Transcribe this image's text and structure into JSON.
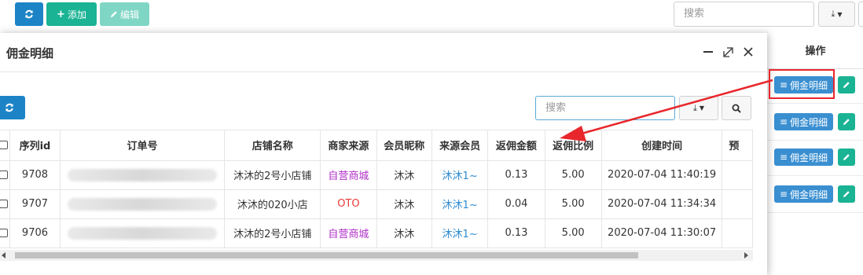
{
  "toolbar": {
    "add_label": "添加",
    "edit_label": "编辑",
    "search_placeholder": "搜索"
  },
  "background_table": {
    "ops_header": "操作",
    "commission_btn_label": "佣金明细",
    "row_count": 4
  },
  "modal": {
    "title": "佣金明细",
    "search_placeholder": "搜索",
    "columns": [
      "序列id",
      "订单号",
      "店铺名称",
      "商家来源",
      "会员昵称",
      "来源会员",
      "返佣金额",
      "返佣比例",
      "创建时间",
      "预"
    ],
    "rows": [
      {
        "id": "9708",
        "order_no": "",
        "shop": "沐沐的2号小店铺",
        "source": "自营商城",
        "nickname": "沐沐",
        "src_member": "沐沐1~",
        "amount": "0.13",
        "ratio": "5.00",
        "created": "2020-07-04 11:40:19"
      },
      {
        "id": "9707",
        "order_no": "",
        "shop": "沐沐的020小店",
        "source": "OTO",
        "nickname": "沐沐",
        "src_member": "沐沐1~",
        "amount": "0.04",
        "ratio": "5.00",
        "created": "2020-07-04 11:34:34"
      },
      {
        "id": "9706",
        "order_no": "",
        "shop": "沐沐的2号小店铺",
        "source": "自营商城",
        "nickname": "沐沐",
        "src_member": "沐沐1~",
        "amount": "0.13",
        "ratio": "5.00",
        "created": "2020-07-04 11:30:07"
      }
    ]
  },
  "colors": {
    "primary_blue": "#1c84c6",
    "green": "#1ab394",
    "annotation_red": "#e8272c",
    "source_self_color": "#b02fc8",
    "source_oto_color": "#e83a3a"
  }
}
